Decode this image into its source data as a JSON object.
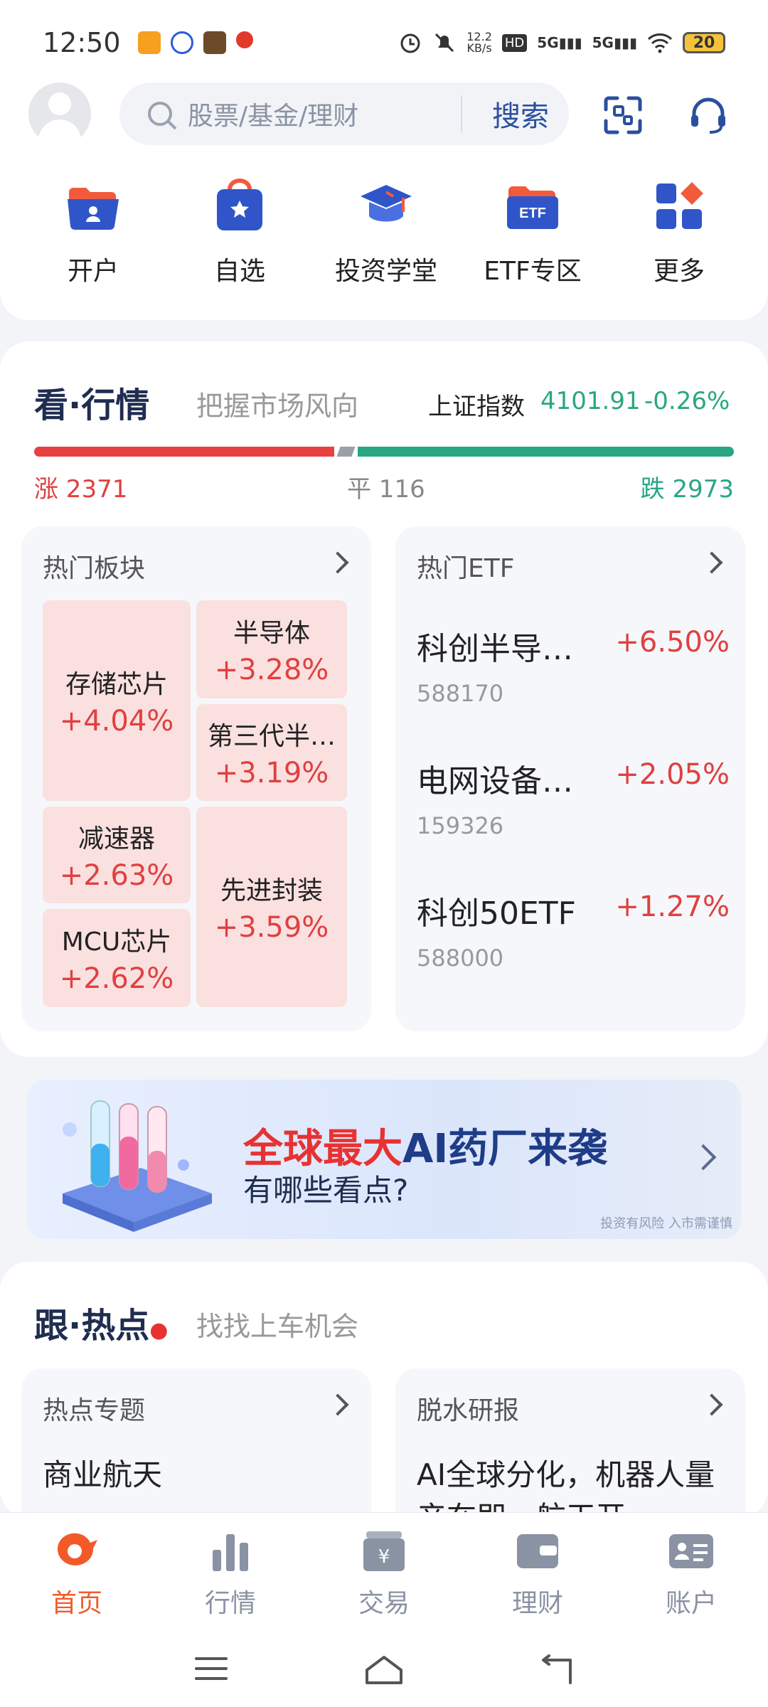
{
  "status": {
    "time": "12:50",
    "net_speed": "12.2\nKB/s",
    "battery": "20"
  },
  "search": {
    "placeholder": "股票/基金/理财",
    "button": "搜索"
  },
  "quick_actions": [
    {
      "label": "开户",
      "icon": "folder-user-icon"
    },
    {
      "label": "自选",
      "icon": "star-bag-icon"
    },
    {
      "label": "投资学堂",
      "icon": "graduation-cap-icon"
    },
    {
      "label": "ETF专区",
      "icon": "etf-folder-icon"
    },
    {
      "label": "更多",
      "icon": "apps-grid-icon"
    }
  ],
  "market": {
    "title_a": "看",
    "title_b": "行情",
    "subtitle": "把握市场风向",
    "index_name": "上证指数",
    "index_value": "4101.91",
    "index_change": "-0.26%",
    "up_label": "涨 2371",
    "flat_label": "平 116",
    "down_label": "跌 2973",
    "up_count": 2371,
    "flat_count": 116,
    "down_count": 2973,
    "hot_sectors_title": "热门板块",
    "hot_etf_title": "热门ETF",
    "sectors": [
      {
        "name": "存储芯片",
        "change": "+4.04%"
      },
      {
        "name": "半导体",
        "change": "+3.28%"
      },
      {
        "name": "第三代半…",
        "change": "+3.19%"
      },
      {
        "name": "减速器",
        "change": "+2.63%"
      },
      {
        "name": "先进封装",
        "change": "+3.59%"
      },
      {
        "name": "MCU芯片",
        "change": "+2.62%"
      }
    ],
    "etfs": [
      {
        "name": "科创半导…",
        "change": "+6.50%",
        "code": "588170"
      },
      {
        "name": "电网设备…",
        "change": "+2.05%",
        "code": "159326"
      },
      {
        "name": "科创50ETF",
        "change": "+1.27%",
        "code": "588000"
      }
    ]
  },
  "banner": {
    "title_red": "全球最大",
    "title_blue": "AI药厂来袭",
    "subtitle": "有哪些看点?",
    "disclaimer": "投资有风险 入市需谨慎"
  },
  "hot": {
    "title_a": "跟",
    "title_b": "热点",
    "subtitle": "找找上车机会",
    "topics_title": "热点专题",
    "topic_item": "商业航天",
    "reports_title": "脱水研报",
    "report_item": "AI全球分化，机器人量产在即，航天开…"
  },
  "tabs": [
    {
      "label": "首页",
      "active": true
    },
    {
      "label": "行情",
      "active": false
    },
    {
      "label": "交易",
      "active": false
    },
    {
      "label": "理财",
      "active": false
    },
    {
      "label": "账户",
      "active": false
    }
  ],
  "colors": {
    "up": "#e04040",
    "down": "#2aa683",
    "accent": "#f25a28",
    "brand": "#2a4f9e"
  }
}
